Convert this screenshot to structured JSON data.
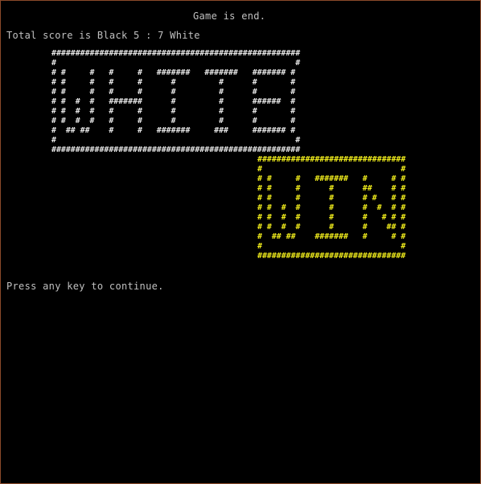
{
  "console": {
    "status_text": "Game is end.",
    "score_text": "Total score is Black 5 : 7 White",
    "prompt_text": "Press any key to continue."
  },
  "banners": {
    "white_banner": "####################################################\n#                                                  #\n# #     #   #     #   #######   #######   ####### #\n# #     #   #     #      #         #      #       #\n# #     #   #     #      #         #      #       #\n# #  #  #   #######      #         #      ######  #\n# #  #  #   #     #      #         #      #       #\n# #  #  #   #     #      #         #      #       #\n#  ## ##    #     #   #######     ###     ####### #\n#                                                  #\n####################################################",
    "win_banner": "###############################\n#                             #\n# #     #   #######   #     # #\n# #     #      #      ##    # #\n# #     #      #      # #   # #\n# #  #  #      #      #  #  # #\n# #  #  #      #      #   # # #\n# #  #  #      #      #    ## #\n#  ## ##    #######   #     # #\n#                             #\n###############################",
    "white_color": "#e8e8e8",
    "win_color": "#f2ee1c",
    "background_color": "#000000"
  }
}
